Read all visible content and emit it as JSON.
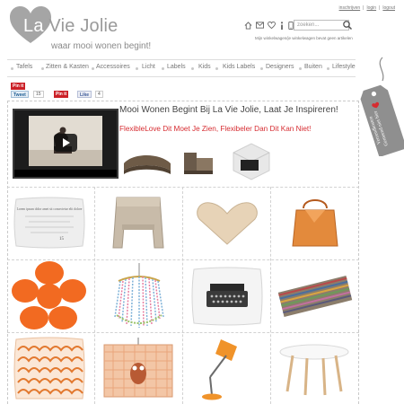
{
  "brand": {
    "title_part1": "La",
    "title_part2": "Vie Jolie",
    "tagline": "waar mooi wonen begint!"
  },
  "toplinks": {
    "register": "inschrijven",
    "login": "login",
    "logout": "logout"
  },
  "header": {
    "search_placeholder": "zoeken...",
    "cart_text": "Mijn winkelwagen/je winkelwagen bevat geen artikelen"
  },
  "nav": {
    "items": [
      "Tafels",
      "Zitten & Kasten",
      "Accessoires",
      "Licht",
      "Labels",
      "Kids",
      "Kids Labels",
      "Designers",
      "Buiten",
      "Lifestyle"
    ]
  },
  "social": {
    "pinit_top": "Pin it",
    "tweet": "Tweet",
    "tweet_count": "15",
    "pinit": "Pin it",
    "like": "Like",
    "like_count": "4"
  },
  "tag": {
    "line1": "Verzendkosten",
    "line2": "Gemeend niet hier"
  },
  "feature": {
    "headline": "Mooi Wonen Begint Bij La Vie Jolie, Laat Je Inspireren!",
    "tagline": "FlexibleLove  Dit Moet Je Zien, Flexibeler Dan Dit Kan Niet!"
  },
  "products": {
    "pillow_text": "Lorem ipsum dolor amet sit consectetur elit dolore",
    "pillow_date": "15"
  },
  "colors": {
    "accent_red": "#d62b30",
    "orange": "#f26a21",
    "logo_gray": "#9a9a9a"
  }
}
